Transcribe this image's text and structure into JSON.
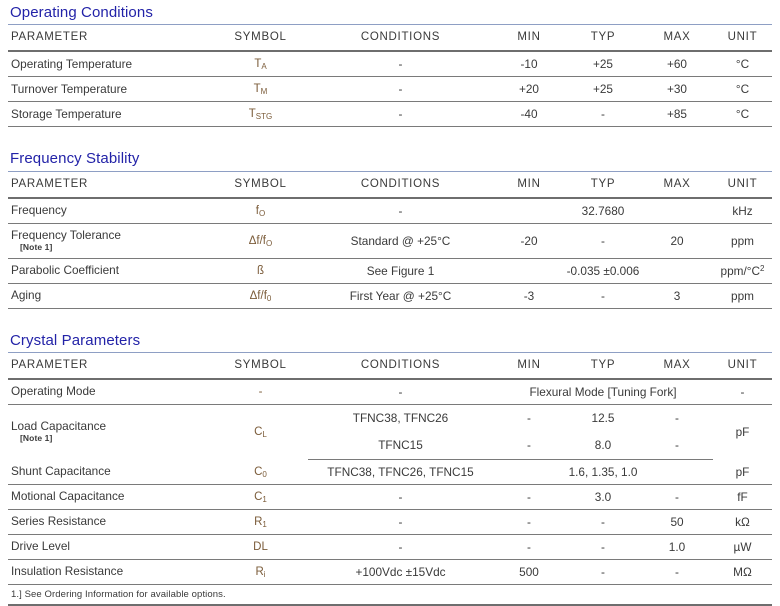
{
  "columns": [
    "PARAMETER",
    "SYMBOL",
    "CONDITIONS",
    "MIN",
    "TYP",
    "MAX",
    "UNIT"
  ],
  "sections": [
    {
      "title": "Operating Conditions",
      "rows": [
        {
          "parameter": "Operating Temperature",
          "symbol_base": "T",
          "symbol_sub": "A",
          "conditions": "-",
          "min": "-10",
          "typ": "+25",
          "max": "+60",
          "unit": "°C"
        },
        {
          "parameter": "Turnover Temperature",
          "symbol_base": "T",
          "symbol_sub": "M",
          "conditions": "-",
          "min": "+20",
          "typ": "+25",
          "max": "+30",
          "unit": "°C"
        },
        {
          "parameter": "Storage Temperature",
          "symbol_base": "T",
          "symbol_sub": "STG",
          "conditions": "-",
          "min": "-40",
          "typ": "-",
          "max": "+85",
          "unit": "°C"
        }
      ]
    },
    {
      "title": "Frequency Stability",
      "rows": [
        {
          "parameter": "Frequency",
          "symbol_base": "f",
          "symbol_sub": "O",
          "conditions": "-",
          "min": "",
          "typ": "32.7680",
          "max": "",
          "unit": "kHz"
        },
        {
          "parameter": "Frequency Tolerance",
          "note": "[Note 1]",
          "symbol_base": "Δf/f",
          "symbol_sub": "O",
          "conditions": "Standard @ +25°C",
          "min": "-20",
          "typ": "-",
          "max": "20",
          "unit": "ppm"
        },
        {
          "parameter": "Parabolic Coefficient",
          "symbol_base": "ß",
          "symbol_sub": "",
          "conditions": "See Figure 1",
          "span_value": "-0.035 ±0.006",
          "unit_base": "ppm/°C",
          "unit_sup": "2"
        },
        {
          "parameter": "Aging",
          "symbol_base": "Δf/f",
          "symbol_sub": "0",
          "conditions": "First Year @ +25°C",
          "min": "-3",
          "typ": "-",
          "max": "3",
          "unit": "ppm"
        }
      ]
    },
    {
      "title": "Crystal Parameters",
      "rows": [
        {
          "parameter": "Operating Mode",
          "symbol_base": "-",
          "symbol_sub": "",
          "conditions": "-",
          "span_value": "Flexural Mode [Tuning Fork]",
          "unit": "-"
        },
        {
          "parameter": "Load Capacitance",
          "note": "[Note 1]",
          "symbol_base": "C",
          "symbol_sub": "L",
          "conditions": "TFNC38, TFNC26",
          "min": "-",
          "typ": "12.5",
          "max": "-",
          "unit": "pF",
          "conditions2": "TFNC15",
          "min2": "-",
          "typ2": "8.0",
          "max2": "-"
        },
        {
          "parameter": "Shunt Capacitance",
          "symbol_base": "C",
          "symbol_sub": "0",
          "conditions": "TFNC38, TFNC26, TFNC15",
          "span_value": "1.6, 1.35, 1.0",
          "unit": "pF"
        },
        {
          "parameter": "Motional Capacitance",
          "symbol_base": "C",
          "symbol_sub": "1",
          "conditions": "-",
          "min": "-",
          "typ": "3.0",
          "max": "-",
          "unit": "fF"
        },
        {
          "parameter": "Series Resistance",
          "symbol_base": "R",
          "symbol_sub": "1",
          "conditions": "-",
          "min": "-",
          "typ": "-",
          "max": "50",
          "unit": "kΩ"
        },
        {
          "parameter": "Drive Level",
          "symbol_base": "DL",
          "symbol_sub": "",
          "conditions": "-",
          "min": "-",
          "typ": "-",
          "max": "1.0",
          "unit": "µW"
        },
        {
          "parameter": "Insulation Resistance",
          "symbol_base": "R",
          "symbol_sub": "i",
          "conditions": "+100Vdc ±15Vdc",
          "min": "500",
          "typ": "-",
          "max": "-",
          "unit": "MΩ"
        }
      ]
    }
  ],
  "footnote": "1.]  See Ordering Information for available options.",
  "colors": {
    "section_title": "#2323a8",
    "symbol_text": "#7b5c3a",
    "body_text": "#3a3a3a",
    "rule": "#7a7a7a",
    "heavy_rule": "#6e6e6e",
    "title_underline": "#8e9fc4"
  }
}
